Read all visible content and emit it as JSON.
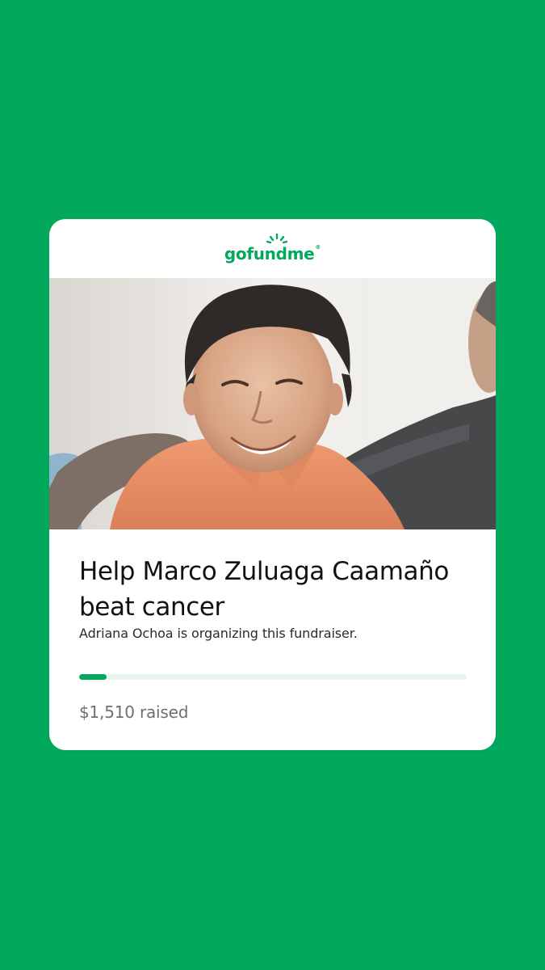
{
  "colors": {
    "background": "#02a95c",
    "brand": "#02a95c",
    "progress_track": "#e6f6ee",
    "progress_fill": "#02a95c"
  },
  "brand": {
    "logo_text": "gofundme"
  },
  "fundraiser": {
    "image_alt": "Photo of Marco Zuluaga Caamaño",
    "title": "Help Marco Zuluaga Caamaño beat cancer",
    "organizer_text": "Adriana Ochoa is organizing this fundraiser.",
    "raised_text": "$1,510 raised",
    "progress_fraction": 0.07
  }
}
